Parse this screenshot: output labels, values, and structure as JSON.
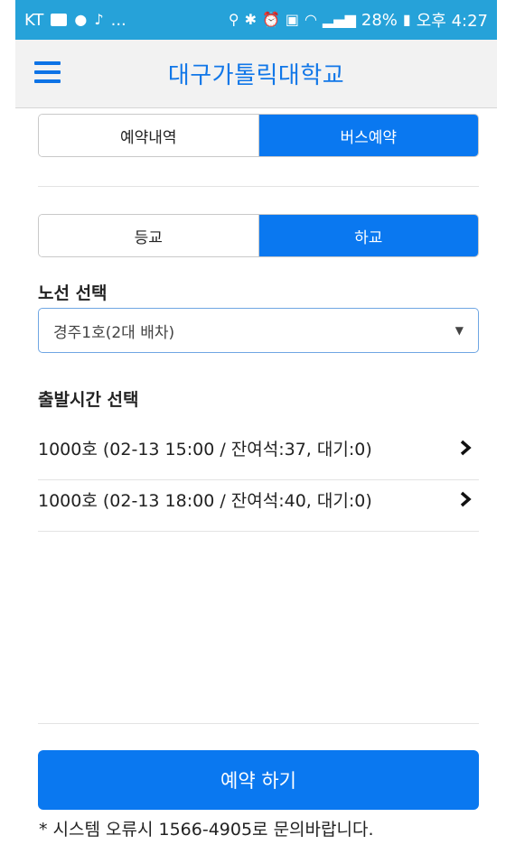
{
  "status_bar": {
    "carrier": "KT",
    "dots": "...",
    "battery": "28%",
    "time": "오후 4:27"
  },
  "header": {
    "title": "대구가톨릭대학교"
  },
  "main_tabs": [
    {
      "label": "예약내역",
      "active": false
    },
    {
      "label": "버스예약",
      "active": true
    }
  ],
  "direction_tabs": [
    {
      "label": "등교",
      "active": false
    },
    {
      "label": "하교",
      "active": true
    }
  ],
  "route_section": {
    "label": "노선 선택",
    "selected": "경주1호(2대 배차)"
  },
  "time_section": {
    "label": "출발시간 선택",
    "items": [
      {
        "text": "1000호 (02-13 15:00 / 잔여석:37, 대기:0)"
      },
      {
        "text": "1000호 (02-13 18:00 / 잔여석:40, 대기:0)"
      }
    ]
  },
  "actions": {
    "reserve_label": "예약 하기"
  },
  "footer": {
    "notice": "* 시스템 오류시 1566-4905로 문의바랍니다."
  },
  "colors": {
    "accent": "#0a78f0",
    "status_bar": "#26a2d9",
    "title": "#1177e8"
  }
}
